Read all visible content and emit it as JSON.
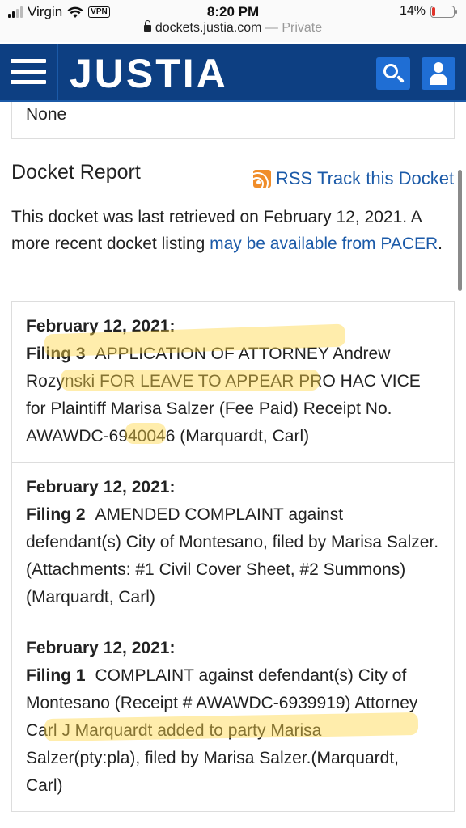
{
  "status_bar": {
    "carrier": "Virgin",
    "vpn": "VPN",
    "time": "8:20 PM",
    "battery_percent": "14%",
    "battery_level": 0.14
  },
  "url_bar": {
    "domain": "dockets.justia.com",
    "separator": " — ",
    "private_label": "Private"
  },
  "header": {
    "logo": "JUSTIA"
  },
  "top_box": {
    "text": "None"
  },
  "docket": {
    "title": "Docket Report",
    "rss_link": "RSS Track this Docket",
    "retrieved_text": "This docket was last retrieved on February 12, 2021. A more recent docket listing ",
    "pacer_link": "may be available from PACER",
    "retrieved_end": "."
  },
  "filings": [
    {
      "date": "February 12, 2021:",
      "label": "Filing 3",
      "text": "APPLICATION OF ATTORNEY Andrew Rozynski FOR LEAVE TO APPEAR PRO HAC VICE for Plaintiff Marisa Salzer (Fee Paid) Receipt No. AWAWDC-6940046 (Marquardt, Carl)"
    },
    {
      "date": "February 12, 2021:",
      "label": "Filing 2",
      "text": "AMENDED COMPLAINT against defendant(s) City of Montesano, filed by Marisa Salzer. (Attachments: #1 Civil Cover Sheet, #2 Summons)(Marquardt, Carl)"
    },
    {
      "date": "February 12, 2021:",
      "label": "Filing 1",
      "text": "COMPLAINT against defendant(s) City of Montesano (Receipt # AWAWDC-6939919) Attorney Carl J Marquardt added to party Marisa Salzer(pty:pla), filed by Marisa Salzer.(Marquardt, Carl)"
    }
  ],
  "colors": {
    "header_bg": "#0d3f82",
    "header_button": "#1f6ed4",
    "link": "#1b5aa8",
    "rss": "#f08d2a",
    "highlight": "#ffd746"
  }
}
